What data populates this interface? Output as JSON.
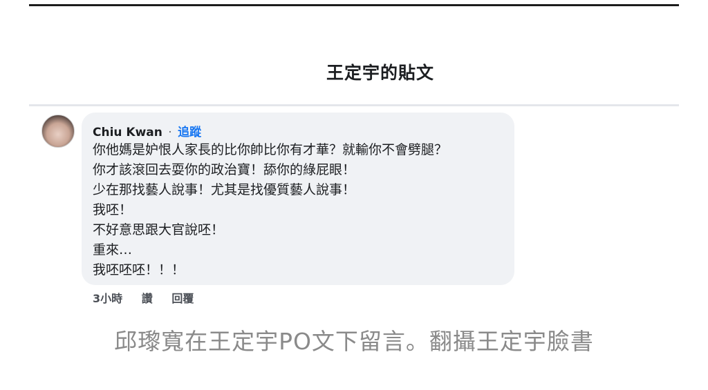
{
  "header": {
    "title": "王定宇的貼文"
  },
  "comment": {
    "author": "Chiu Kwan",
    "separator": "·",
    "follow_label": "追蹤",
    "lines": [
      "你他媽是妒恨人家長的比你帥比你有才華？就輸你不會劈腿？",
      "你才該滾回去耍你的政治寶！舔你的綠屁眼！",
      "少在那找藝人說事！尤其是找優質藝人說事！",
      "我呸！",
      "不好意思跟大官說呸！",
      "重來…",
      "我呸呸呸！！！"
    ],
    "time": "3小時",
    "like_label": "讚",
    "reply_label": "回覆"
  },
  "caption": "邱瓈寬在王定宇PO文下留言。翻攝王定宇臉書",
  "colors": {
    "bubble": "#f0f2f5",
    "link": "#1877f2",
    "caption": "#8a8a8a"
  }
}
